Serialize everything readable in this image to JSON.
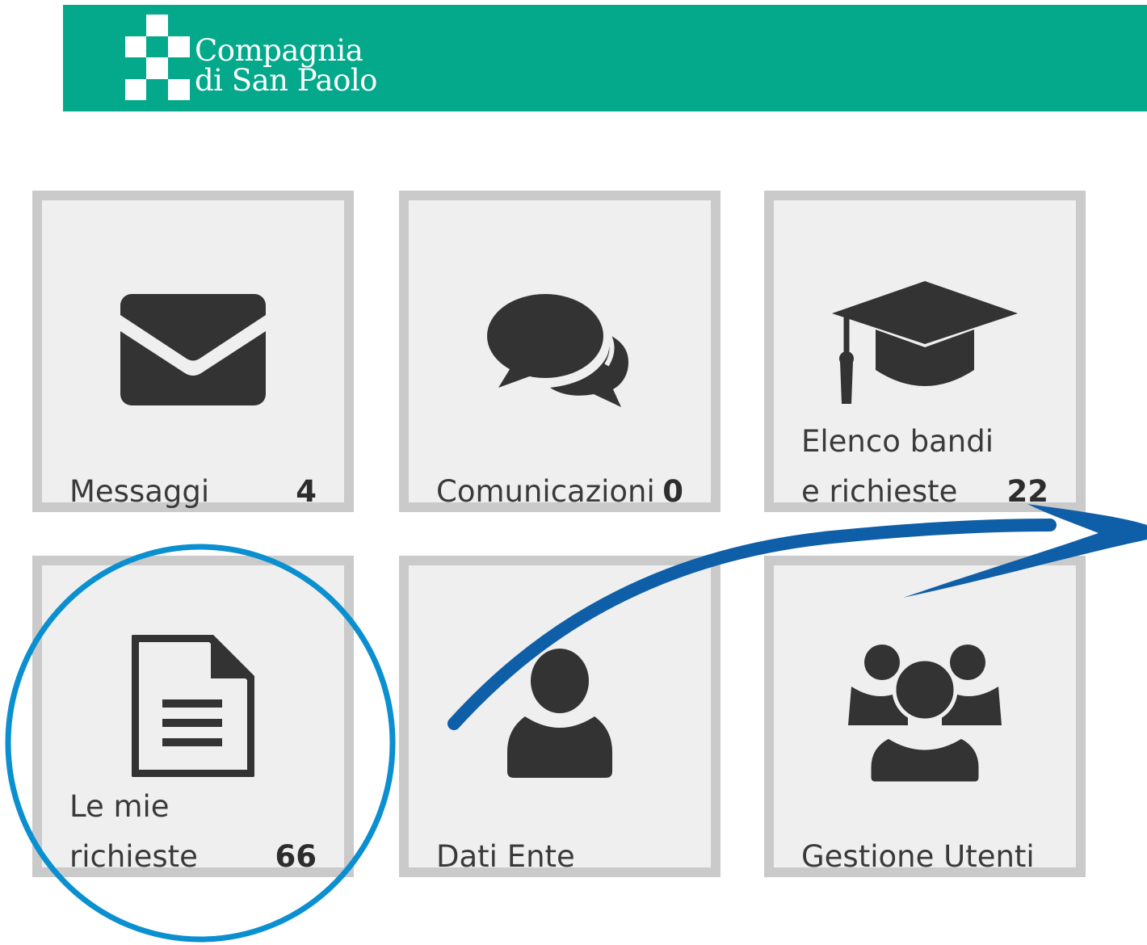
{
  "header": {
    "background": "#03a98a",
    "logo": {
      "line1": "Compagnia",
      "line2": "di San Paolo"
    }
  },
  "tiles": [
    {
      "id": "messaggi",
      "label_lines": [
        "Messaggi"
      ],
      "count": "4",
      "icon": "envelope-icon"
    },
    {
      "id": "comunicazioni",
      "label_lines": [
        "Comunicazioni"
      ],
      "count": "0",
      "icon": "comments-icon"
    },
    {
      "id": "elenco-bandi",
      "label_lines": [
        "Elenco bandi",
        "e richieste"
      ],
      "count": "22",
      "icon": "graduation-cap-icon"
    },
    {
      "id": "le-mie-richieste",
      "label_lines": [
        "Le mie",
        "richieste"
      ],
      "count": "66",
      "icon": "document-icon"
    },
    {
      "id": "dati-ente",
      "label_lines": [
        "Dati Ente"
      ],
      "count": "",
      "icon": "user-icon"
    },
    {
      "id": "gestione-utenti",
      "label_lines": [
        "Gestione Utenti"
      ],
      "count": "",
      "icon": "users-group-icon"
    }
  ],
  "annotations": {
    "highlight_color": "#0a8fd0",
    "arrow_color": "#0f5ea8",
    "highlighted_tile": "Le mie richieste"
  }
}
